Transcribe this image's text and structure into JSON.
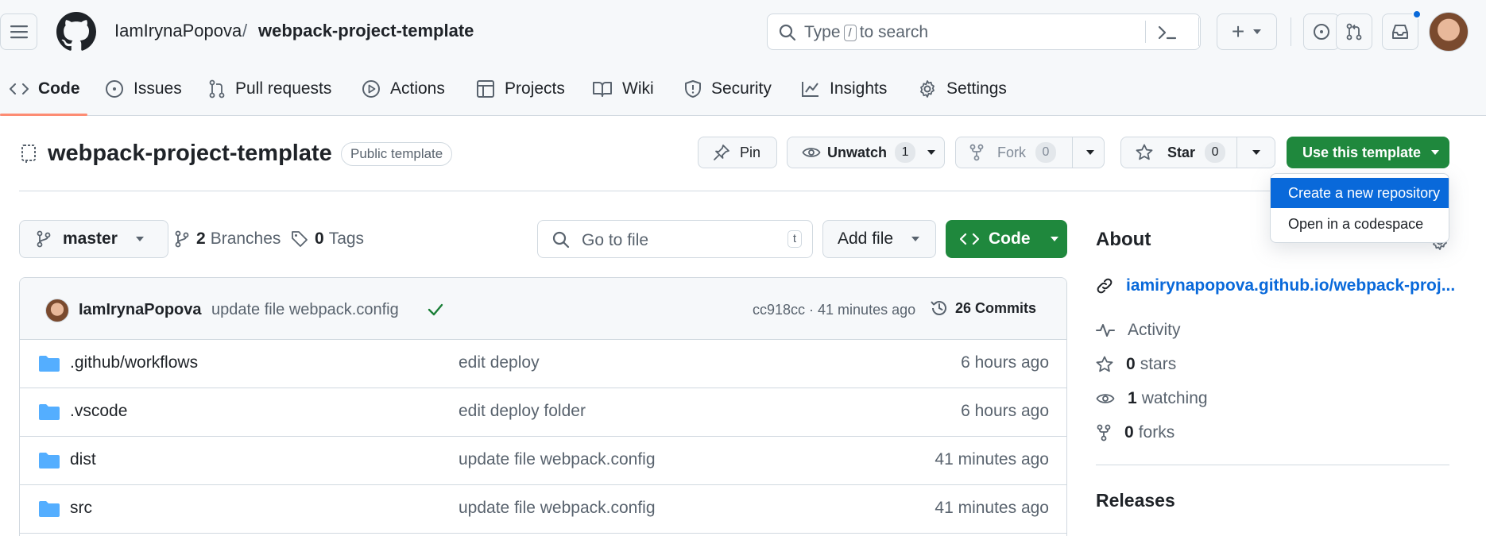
{
  "header": {
    "owner": "IamIrynaPopova",
    "slash": "/",
    "repo": "webpack-project-template",
    "search": {
      "pre": "Type",
      "key": "/",
      "post": "to search"
    },
    "create_label": "+"
  },
  "tabs": [
    {
      "label": "Code",
      "icon": "code-icon"
    },
    {
      "label": "Issues",
      "icon": "issue-icon"
    },
    {
      "label": "Pull requests",
      "icon": "pull-request-icon"
    },
    {
      "label": "Actions",
      "icon": "play-icon"
    },
    {
      "label": "Projects",
      "icon": "table-icon"
    },
    {
      "label": "Wiki",
      "icon": "book-icon"
    },
    {
      "label": "Security",
      "icon": "shield-icon"
    },
    {
      "label": "Insights",
      "icon": "graph-icon"
    },
    {
      "label": "Settings",
      "icon": "gear-icon"
    }
  ],
  "repo_header": {
    "title": "webpack-project-template",
    "visibility": "Public template",
    "pin": "Pin",
    "unwatch": "Unwatch",
    "watch_count": "1",
    "fork": "Fork",
    "fork_count": "0",
    "star": "Star",
    "star_count": "0",
    "use_template": "Use this template"
  },
  "template_menu": {
    "items": [
      "Create a new repository",
      "Open in a codespace"
    ]
  },
  "toolbar": {
    "branch": "master",
    "branches_count": "2",
    "branches_label": "Branches",
    "tags_count": "0",
    "tags_label": "Tags",
    "goto_placeholder": "Go to file",
    "goto_key": "t",
    "add_file": "Add file",
    "code": "Code"
  },
  "latest_commit": {
    "author": "IamIrynaPopova",
    "message": "update file webpack.config",
    "sha_time": "cc918cc · 41 minutes ago",
    "commits_label": "26 Commits"
  },
  "files": [
    {
      "name": ".github/workflows",
      "message": "edit deploy",
      "time": "6 hours ago"
    },
    {
      "name": ".vscode",
      "message": "edit deploy folder",
      "time": "6 hours ago"
    },
    {
      "name": "dist",
      "message": "update file webpack.config",
      "time": "41 minutes ago"
    },
    {
      "name": "src",
      "message": "update file webpack.config",
      "time": "41 minutes ago"
    }
  ],
  "about": {
    "heading": "About",
    "link": "iamirynapopova.github.io/webpack-proj...",
    "activity": "Activity",
    "stars_count": "0",
    "stars_label": "stars",
    "watching_count": "1",
    "watching_label": "watching",
    "forks_count": "0",
    "forks_label": "forks",
    "releases": "Releases"
  },
  "colors": {
    "accent": "#0969da",
    "primary_green": "#1f883d",
    "folder": "#54aeff",
    "tab_underline": "#fd8c73"
  }
}
